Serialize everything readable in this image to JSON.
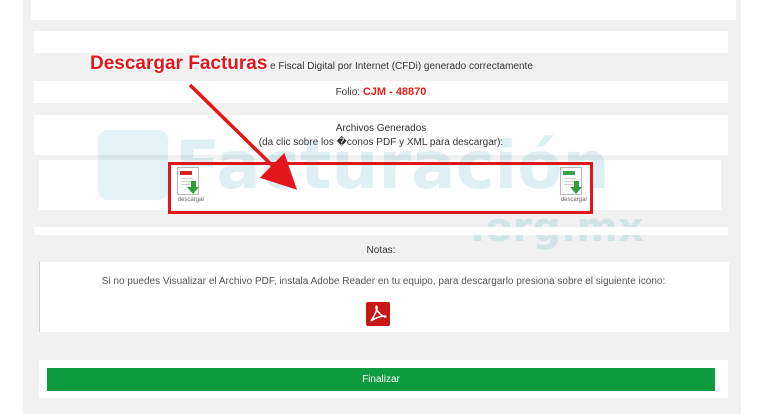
{
  "header_line": "e Fiscal Digital por Internet (CFDi) generado correctamente",
  "folio_label": "Folio: ",
  "folio_value": "CJM - 48870",
  "archivos_title": "Archivos Generados",
  "archivos_hint": "(da clic sobre los �conos PDF y XML para descargar):",
  "pdf_icon_label": "descargar",
  "xml_icon_label": "descargar",
  "notas_title": "Notas:",
  "adobe_note": "Si no puedes Visualizar el Archivo PDF, instala Adobe Reader en tu equipo, para descargarlo presiona sobre el siguiente icono:",
  "finalizar_label": "Finalizar",
  "annotation_label": "Descargar Facturas",
  "watermark": {
    "main": "Facturación",
    "sub": ".org.mx"
  },
  "colors": {
    "accent_red": "#e0201c",
    "button_green": "#0e9a3e",
    "callout_red": "#e3161b"
  }
}
